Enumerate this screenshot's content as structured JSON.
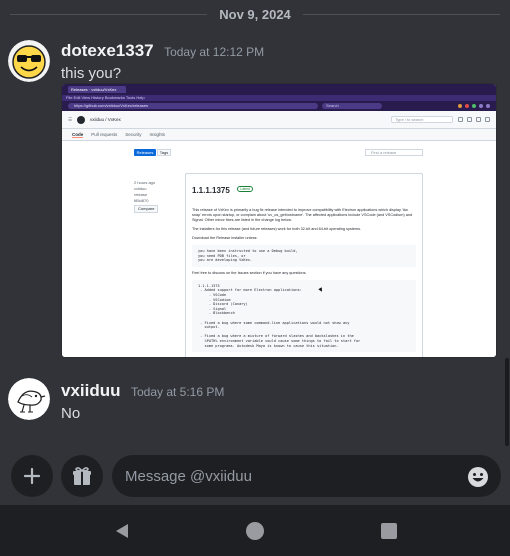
{
  "divider": {
    "date": "Nov 9, 2024"
  },
  "messages": [
    {
      "username": "dotexe1337",
      "timestamp": "Today at 12:12 PM",
      "text": "this you?",
      "avatar_icon": "sunglasses-emoji-avatar-icon"
    },
    {
      "username": "vxiiduu",
      "timestamp": "Today at 5:16 PM",
      "text": "No",
      "avatar_icon": "bird-sketch-avatar-icon"
    }
  ],
  "attachment": {
    "browser_tab": "Releases · vxiiduu/VxKex",
    "menu": "File  Edit  View  History  Bookmarks  Tools  Help",
    "url": "https://github.com/vxiiduu/VxKex/releases",
    "search_placeholder": "Search",
    "repo": "vxiiduu / VxKex",
    "type_search": "Type / to search",
    "nav_tabs": [
      "Code",
      "Pull requests",
      "Security",
      "Insights"
    ],
    "releases_btn": "Releases",
    "tags_btn": "Tags",
    "find_release": "Find a release",
    "side_meta": [
      "2 hours ago",
      "vxiiduu",
      "release",
      "f85d870",
      "Compare"
    ],
    "release_title": "1.1.1.1375",
    "release_badge": "Latest",
    "para1": "This release of VxKex is primarily a bug fix release intended to improve compatibility with Electron applications which display 'Aw snap' errors upon startup, or complain about 'uv_os_gethostname'. The affected applications include VSCode (and VSCodium) and Signal. Other minor fixes are listed in the change log below.",
    "para2": "The installers for this release (and future releases) work for both 32-bit and 64-bit operating systems.",
    "para3": "Download the Release installer unless:",
    "code1": "you have been instructed to use a Debug build,\nyou need PDB files, or\nyou are developing VxKex.",
    "para4": "Feel free to discuss on the Issues section if you have any questions.",
    "code2": "1.1.1.1375\n - Added support for more Electron applications:\n     - VSCode\n     - VSCodium\n     - Discord (Canary)\n     - Signal\n     - Blockbench\n\n - Fixed a bug where some command-line applications would not show any\n   output.\n\n - Fixed a bug where a mixture of forward slashes and backslashes in the\n   %PATH% environment variable could cause some things to fail to start for\n   some programs. Autodesk Maya is known to cause this situation."
  },
  "input": {
    "placeholder": "Message @vxiiduu"
  },
  "colors": {
    "background": "#313338",
    "input": "#1e1f22",
    "text": "#dbdee1",
    "muted": "#949ba4"
  }
}
